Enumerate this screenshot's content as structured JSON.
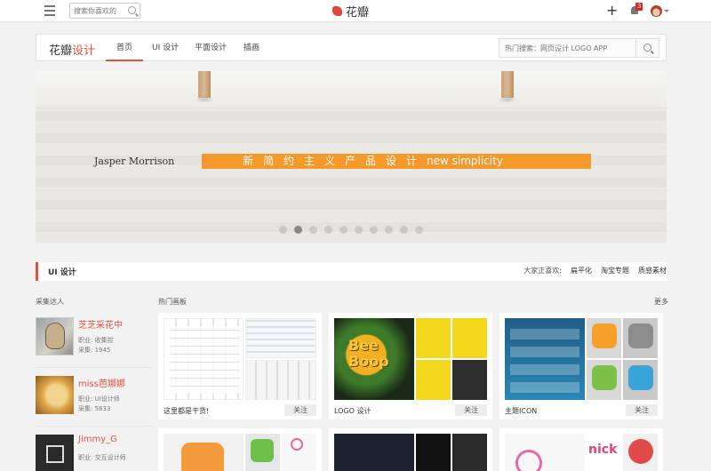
{
  "topbar": {
    "search_placeholder": "搜索你喜欢的",
    "logo_text": "花瓣",
    "add_icon": "plus-icon",
    "notifications": {
      "icon": "bell-icon",
      "count": "3"
    },
    "avatar_icon": "user-avatar"
  },
  "subnav": {
    "brand_part1": "花瓣",
    "brand_part2": "设计",
    "tabs": [
      {
        "label": "首页",
        "active": true
      },
      {
        "label": "UI 设计",
        "active": false
      },
      {
        "label": "平面设计",
        "active": false
      },
      {
        "label": "插画",
        "active": false
      }
    ],
    "search_placeholder": "热门搜索：网页设计 LOGO APP"
  },
  "banner": {
    "signature": "Jasper Morrison",
    "tagline_cn": "新简约主义产品设计",
    "tagline_en": "new simplicity",
    "slide_count": 10,
    "active_slide": 1
  },
  "section": {
    "title": "UI 设计",
    "like_label": "大家正喜欢:",
    "like_tags": [
      "扁平化",
      "淘宝专题",
      "质感素材"
    ]
  },
  "collectors": {
    "title": "采集达人",
    "items": [
      {
        "name": "芝芝采花中",
        "job": "职业: 收集控",
        "count": "采集: 1945"
      },
      {
        "name": "miss芭娜娜",
        "job": "职业: UI设计师",
        "count": "采集: 5833"
      },
      {
        "name": "Jimmy_G",
        "job": "职业: 交互设计师",
        "count": ""
      }
    ]
  },
  "boards": {
    "title": "热门画板",
    "more": "更多",
    "items": [
      {
        "name": "这里都是干货!",
        "follow": "关注"
      },
      {
        "name": "LOGO 设计",
        "follow": "关注"
      },
      {
        "name": "主题ICON",
        "follow": "关注"
      }
    ]
  },
  "colors": {
    "accent": "#e0513f",
    "tagline_bg": "#f4992a"
  }
}
